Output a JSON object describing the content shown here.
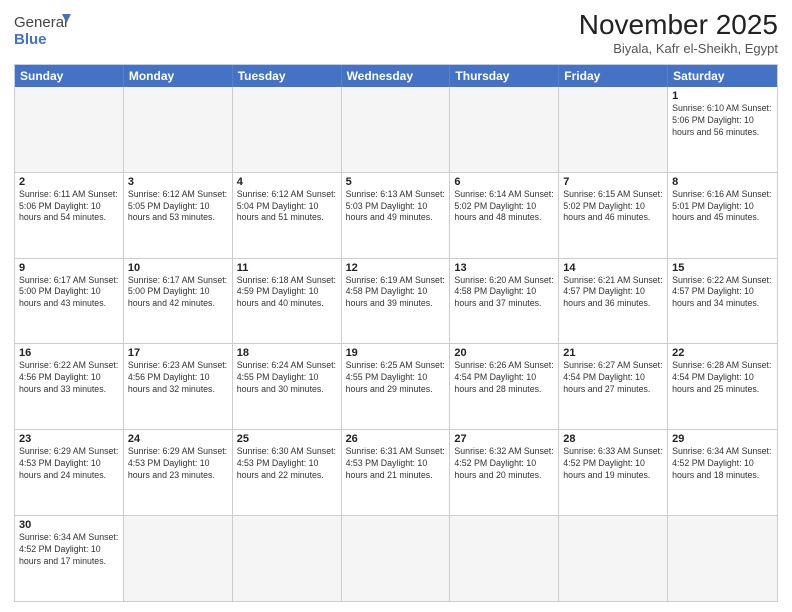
{
  "logo": {
    "text_general": "General",
    "text_blue": "Blue"
  },
  "title": "November 2025",
  "subtitle": "Biyala, Kafr el-Sheikh, Egypt",
  "days_header": [
    "Sunday",
    "Monday",
    "Tuesday",
    "Wednesday",
    "Thursday",
    "Friday",
    "Saturday"
  ],
  "weeks": [
    [
      {
        "day": "",
        "info": ""
      },
      {
        "day": "",
        "info": ""
      },
      {
        "day": "",
        "info": ""
      },
      {
        "day": "",
        "info": ""
      },
      {
        "day": "",
        "info": ""
      },
      {
        "day": "",
        "info": ""
      },
      {
        "day": "1",
        "info": "Sunrise: 6:10 AM\nSunset: 5:06 PM\nDaylight: 10 hours and 56 minutes."
      }
    ],
    [
      {
        "day": "2",
        "info": "Sunrise: 6:11 AM\nSunset: 5:06 PM\nDaylight: 10 hours and 54 minutes."
      },
      {
        "day": "3",
        "info": "Sunrise: 6:12 AM\nSunset: 5:05 PM\nDaylight: 10 hours and 53 minutes."
      },
      {
        "day": "4",
        "info": "Sunrise: 6:12 AM\nSunset: 5:04 PM\nDaylight: 10 hours and 51 minutes."
      },
      {
        "day": "5",
        "info": "Sunrise: 6:13 AM\nSunset: 5:03 PM\nDaylight: 10 hours and 49 minutes."
      },
      {
        "day": "6",
        "info": "Sunrise: 6:14 AM\nSunset: 5:02 PM\nDaylight: 10 hours and 48 minutes."
      },
      {
        "day": "7",
        "info": "Sunrise: 6:15 AM\nSunset: 5:02 PM\nDaylight: 10 hours and 46 minutes."
      },
      {
        "day": "8",
        "info": "Sunrise: 6:16 AM\nSunset: 5:01 PM\nDaylight: 10 hours and 45 minutes."
      }
    ],
    [
      {
        "day": "9",
        "info": "Sunrise: 6:17 AM\nSunset: 5:00 PM\nDaylight: 10 hours and 43 minutes."
      },
      {
        "day": "10",
        "info": "Sunrise: 6:17 AM\nSunset: 5:00 PM\nDaylight: 10 hours and 42 minutes."
      },
      {
        "day": "11",
        "info": "Sunrise: 6:18 AM\nSunset: 4:59 PM\nDaylight: 10 hours and 40 minutes."
      },
      {
        "day": "12",
        "info": "Sunrise: 6:19 AM\nSunset: 4:58 PM\nDaylight: 10 hours and 39 minutes."
      },
      {
        "day": "13",
        "info": "Sunrise: 6:20 AM\nSunset: 4:58 PM\nDaylight: 10 hours and 37 minutes."
      },
      {
        "day": "14",
        "info": "Sunrise: 6:21 AM\nSunset: 4:57 PM\nDaylight: 10 hours and 36 minutes."
      },
      {
        "day": "15",
        "info": "Sunrise: 6:22 AM\nSunset: 4:57 PM\nDaylight: 10 hours and 34 minutes."
      }
    ],
    [
      {
        "day": "16",
        "info": "Sunrise: 6:22 AM\nSunset: 4:56 PM\nDaylight: 10 hours and 33 minutes."
      },
      {
        "day": "17",
        "info": "Sunrise: 6:23 AM\nSunset: 4:56 PM\nDaylight: 10 hours and 32 minutes."
      },
      {
        "day": "18",
        "info": "Sunrise: 6:24 AM\nSunset: 4:55 PM\nDaylight: 10 hours and 30 minutes."
      },
      {
        "day": "19",
        "info": "Sunrise: 6:25 AM\nSunset: 4:55 PM\nDaylight: 10 hours and 29 minutes."
      },
      {
        "day": "20",
        "info": "Sunrise: 6:26 AM\nSunset: 4:54 PM\nDaylight: 10 hours and 28 minutes."
      },
      {
        "day": "21",
        "info": "Sunrise: 6:27 AM\nSunset: 4:54 PM\nDaylight: 10 hours and 27 minutes."
      },
      {
        "day": "22",
        "info": "Sunrise: 6:28 AM\nSunset: 4:54 PM\nDaylight: 10 hours and 25 minutes."
      }
    ],
    [
      {
        "day": "23",
        "info": "Sunrise: 6:29 AM\nSunset: 4:53 PM\nDaylight: 10 hours and 24 minutes."
      },
      {
        "day": "24",
        "info": "Sunrise: 6:29 AM\nSunset: 4:53 PM\nDaylight: 10 hours and 23 minutes."
      },
      {
        "day": "25",
        "info": "Sunrise: 6:30 AM\nSunset: 4:53 PM\nDaylight: 10 hours and 22 minutes."
      },
      {
        "day": "26",
        "info": "Sunrise: 6:31 AM\nSunset: 4:53 PM\nDaylight: 10 hours and 21 minutes."
      },
      {
        "day": "27",
        "info": "Sunrise: 6:32 AM\nSunset: 4:52 PM\nDaylight: 10 hours and 20 minutes."
      },
      {
        "day": "28",
        "info": "Sunrise: 6:33 AM\nSunset: 4:52 PM\nDaylight: 10 hours and 19 minutes."
      },
      {
        "day": "29",
        "info": "Sunrise: 6:34 AM\nSunset: 4:52 PM\nDaylight: 10 hours and 18 minutes."
      }
    ],
    [
      {
        "day": "30",
        "info": "Sunrise: 6:34 AM\nSunset: 4:52 PM\nDaylight: 10 hours and 17 minutes."
      },
      {
        "day": "",
        "info": ""
      },
      {
        "day": "",
        "info": ""
      },
      {
        "day": "",
        "info": ""
      },
      {
        "day": "",
        "info": ""
      },
      {
        "day": "",
        "info": ""
      },
      {
        "day": "",
        "info": ""
      }
    ]
  ]
}
